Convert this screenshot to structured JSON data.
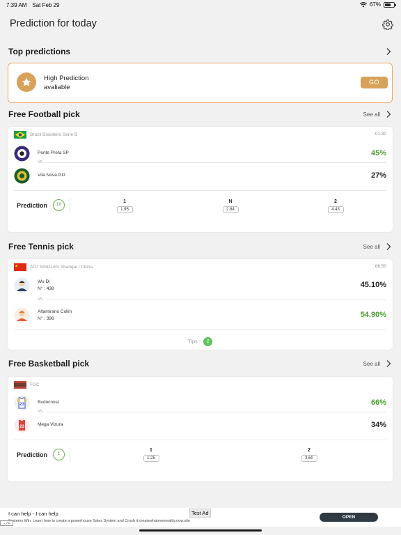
{
  "status_bar": {
    "time": "7:39 AM",
    "date": "Sat Feb 29",
    "battery_text": "67%",
    "battery_level": 0.67
  },
  "header": {
    "title": "Prediction for today",
    "settings_icon": "gear-icon"
  },
  "top_predictions": {
    "title": "Top predictions",
    "card_line1": "High Prediction",
    "card_line2": "avaliable",
    "go_label": "GO",
    "accent_color": "#d9a25a"
  },
  "football": {
    "section_title": "Free Football pick",
    "see_all": "See all",
    "league": "Brazil Brasileiro Serie B",
    "time": "01:30",
    "team1": {
      "name": "Ponte Preta SP",
      "pct": "45%"
    },
    "vs": "VS",
    "team2": {
      "name": "Vila Nova GO",
      "pct": "27%"
    },
    "prediction_label": "Prediction",
    "prediction_pick": "1X",
    "odds": [
      {
        "label": "1",
        "value": "1.95"
      },
      {
        "label": "N",
        "value": "2.84"
      },
      {
        "label": "2",
        "value": "4.43"
      }
    ]
  },
  "tennis": {
    "section_title": "Free Tennis pick",
    "see_all": "See all",
    "league": "ATP SINGLES Shangai / China",
    "time": "06:50",
    "player1": {
      "name": "Wu Di",
      "rank": "N° : 438",
      "pct": "45.10%"
    },
    "vs": "VS",
    "player2": {
      "name": "Altamirano Collin",
      "rank": "N° : 396",
      "pct": "54.90%"
    },
    "tips_label": "Tips :",
    "tips_count": "2"
  },
  "basketball": {
    "section_title": "Free Basketball pick",
    "see_all": "See all",
    "league": "FGC",
    "team1": {
      "name": "Budocnost",
      "pct": "66%"
    },
    "vs": "VS",
    "team2": {
      "name": "Mega Vizura",
      "pct": "34%"
    },
    "prediction_label": "Prediction",
    "prediction_pick": "1",
    "odds": [
      {
        "label": "1",
        "value": "1.25"
      },
      {
        "label": "2",
        "value": "3.60"
      }
    ]
  },
  "ad": {
    "title": "I can help - I can help",
    "test_label": "Test Ad",
    "description": "Systems Win. Learn how to create a powerhouse Sales System and Crush it createwhateverreality.now.site",
    "ad_badge": "Ad",
    "open_label": "OPEN"
  }
}
